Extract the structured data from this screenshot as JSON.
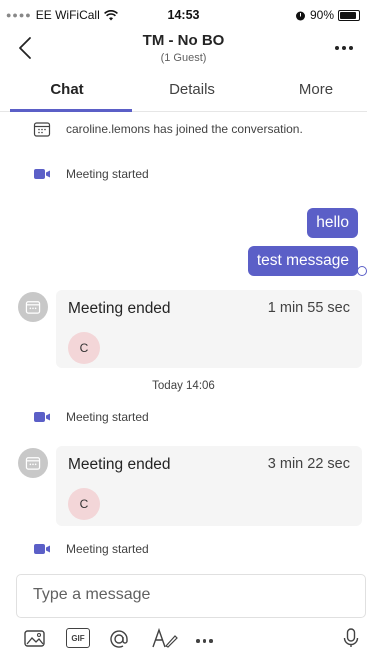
{
  "status_bar": {
    "carrier": "EE WiFiCall",
    "time": "14:53",
    "battery": "90%",
    "battery_level": 0.9
  },
  "header": {
    "title": "TM - No BO",
    "subtitle": "(1 Guest)"
  },
  "tabs": [
    {
      "label": "Chat",
      "selected": true
    },
    {
      "label": "Details",
      "selected": false
    },
    {
      "label": "More",
      "selected": false
    }
  ],
  "feed": {
    "join_notice": "caroline.lemons has joined the conversation.",
    "meeting_started_1": "Meeting started",
    "messages": [
      "hello",
      "test message"
    ],
    "meeting_ended_1": {
      "title": "Meeting ended",
      "duration": "1 min 55 sec",
      "participant_initial": "C"
    },
    "date_separator": "Today 14:06",
    "meeting_started_2": "Meeting started",
    "meeting_ended_2": {
      "title": "Meeting ended",
      "duration": "3 min 22 sec",
      "participant_initial": "C"
    },
    "meeting_started_3": "Meeting started"
  },
  "composer": {
    "placeholder": "Type a message"
  },
  "toolbar": {
    "gif_label": "GIF"
  },
  "colors": {
    "accent": "#5b5fc7",
    "card_bg": "#f5f5f5",
    "participant_bg": "#f3d6d8"
  }
}
